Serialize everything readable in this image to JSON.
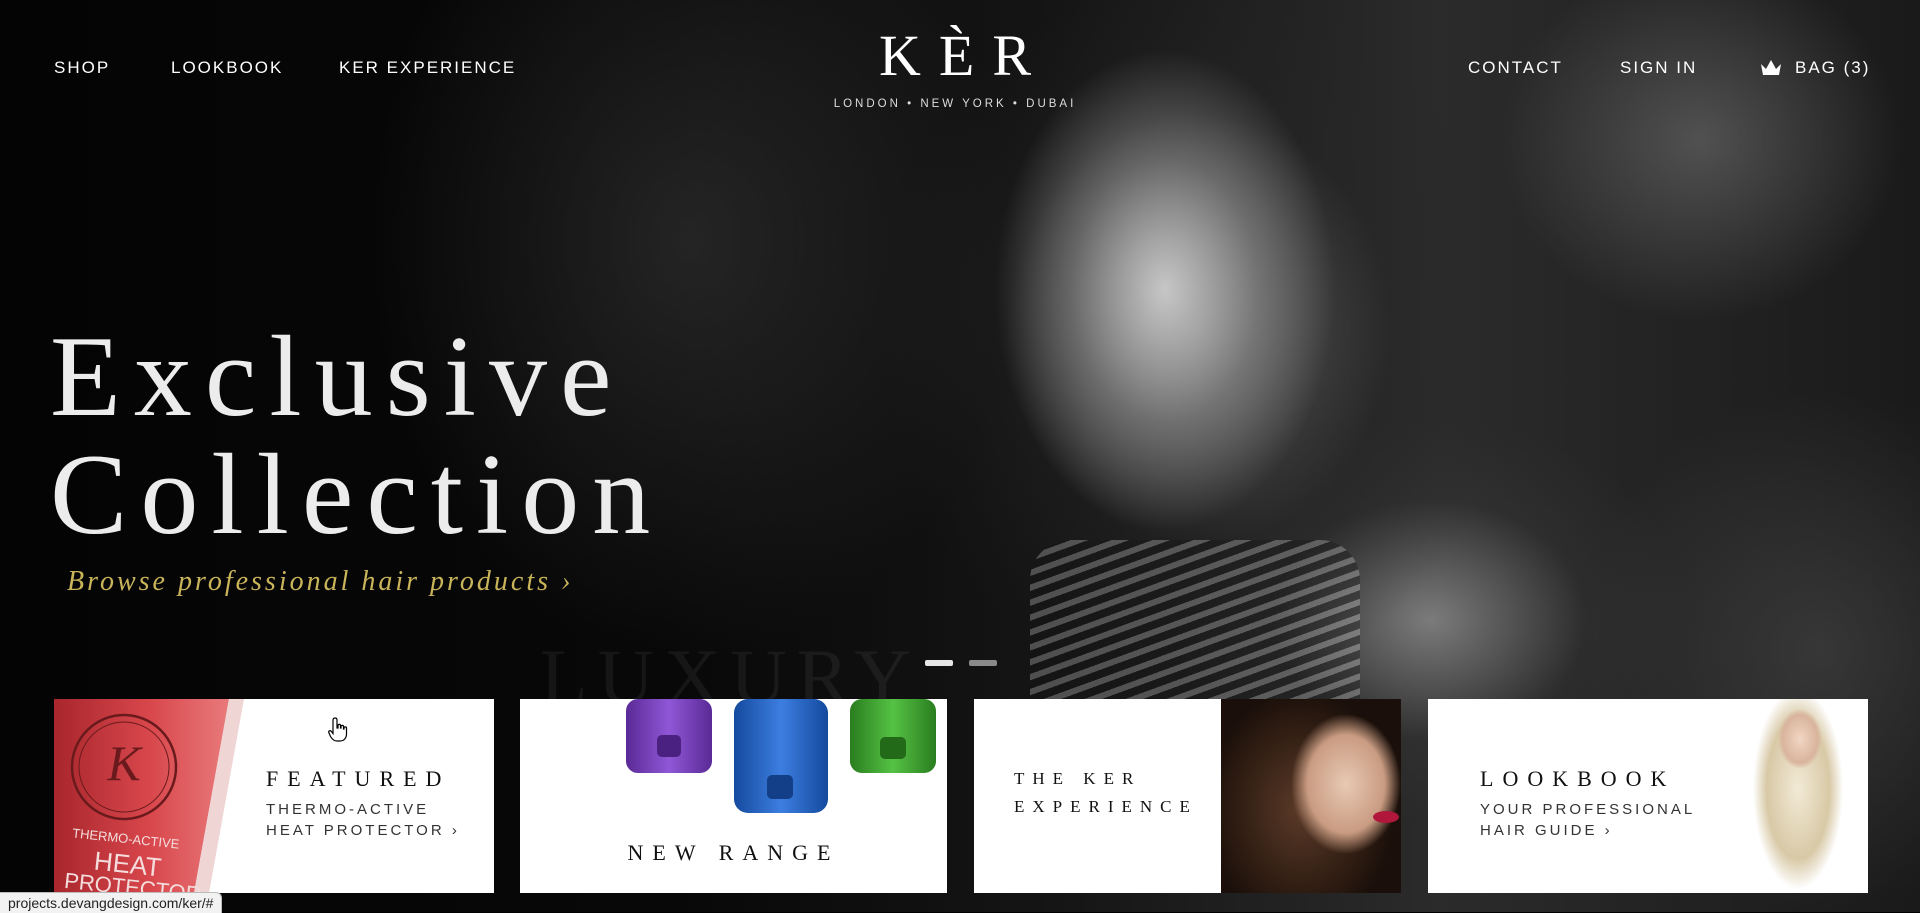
{
  "nav": {
    "shop": "SHOP",
    "lookbook": "LOOKBOOK",
    "ker_experience": "KER EXPERIENCE",
    "contact": "CONTACT",
    "sign_in": "SIGN IN",
    "bag": "BAG (3)"
  },
  "logo": {
    "name": "KÈR",
    "tagline": "LONDON • NEW YORK • DUBAI"
  },
  "hero": {
    "headline_line1": "Exclusive",
    "headline_line2": "Collection",
    "cta": "Browse professional hair products ›",
    "watermark": "LUXURY",
    "slides": 2,
    "active_slide": 1
  },
  "cards": {
    "featured": {
      "title": "FEATURED",
      "sub_line1": "THERMO-ACTIVE",
      "sub_line2": "HEAT PROTECTOR ›",
      "product_monogram": "K",
      "product_line1": "THERMO-ACTIVE",
      "product_line2": "HEAT",
      "product_line3": "PROTECTOR"
    },
    "new_range": {
      "title": "NEW RANGE"
    },
    "experience": {
      "title_line1": "THE KER",
      "title_line2": "EXPERIENCE"
    },
    "lookbook": {
      "title": "LOOKBOOK",
      "sub_line1": "YOUR PROFESSIONAL",
      "sub_line2": "HAIR GUIDE ›"
    }
  },
  "status_bar": {
    "url": "projects.devangdesign.com/ker/#"
  },
  "colors": {
    "accent_gold": "#c9b45a",
    "product_red": "#c8393f",
    "bottle_purple": "#7b3fc0",
    "bottle_blue": "#1f5fc8",
    "bottle_green": "#3fa52c"
  }
}
